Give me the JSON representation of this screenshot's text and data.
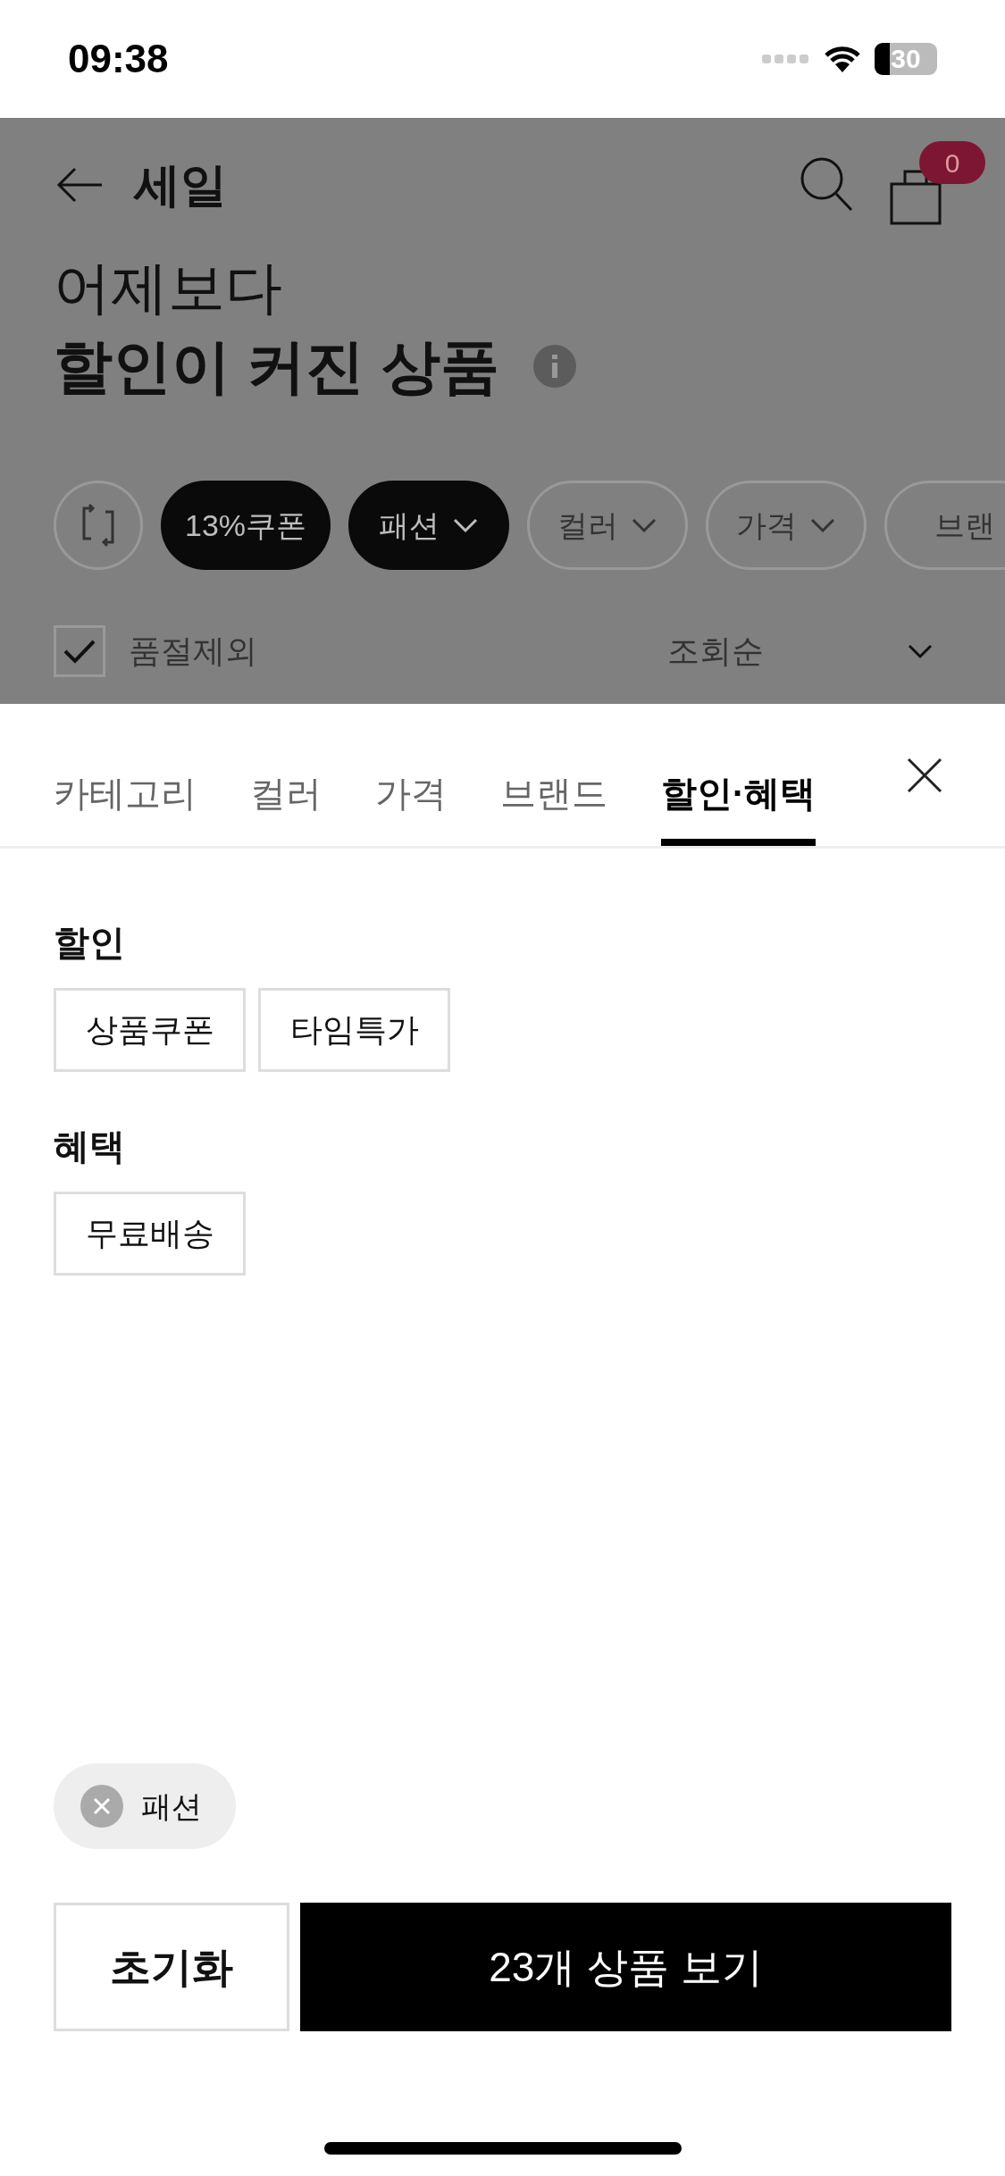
{
  "status_bar": {
    "time": "09:38",
    "battery": "30"
  },
  "header": {
    "title": "세일",
    "cart_count": "0"
  },
  "page_title": {
    "line1": "어제보다",
    "line2": "할인이 커진 상품"
  },
  "filter_chips": [
    {
      "kind": "reset"
    },
    {
      "kind": "chip",
      "label": "13%쿠폰",
      "selected": true,
      "dropdown": false
    },
    {
      "kind": "chip",
      "label": "패션",
      "selected": true,
      "dropdown": true
    },
    {
      "kind": "chip",
      "label": "컬러",
      "selected": false,
      "dropdown": true
    },
    {
      "kind": "chip",
      "label": "가격",
      "selected": false,
      "dropdown": true
    },
    {
      "kind": "chip",
      "label": "브랜",
      "selected": false,
      "dropdown": false
    }
  ],
  "exclude_sold_out": {
    "label": "품절제외",
    "checked": true
  },
  "sort": {
    "label": "조회순"
  },
  "sheet": {
    "tabs": [
      {
        "label": "카테고리",
        "selected": false
      },
      {
        "label": "컬러",
        "selected": false
      },
      {
        "label": "가격",
        "selected": false
      },
      {
        "label": "브랜드",
        "selected": false
      },
      {
        "label": "할인·혜택",
        "selected": true
      }
    ],
    "sections": [
      {
        "title": "할인",
        "options": [
          {
            "label": "상품쿠폰",
            "selected": false
          },
          {
            "label": "타임특가",
            "selected": false
          }
        ]
      },
      {
        "title": "혜택",
        "options": [
          {
            "label": "무료배송",
            "selected": false
          }
        ]
      }
    ],
    "applied": [
      {
        "label": "패션"
      }
    ],
    "reset_button": "초기화",
    "apply_button": "23개 상품 보기"
  }
}
